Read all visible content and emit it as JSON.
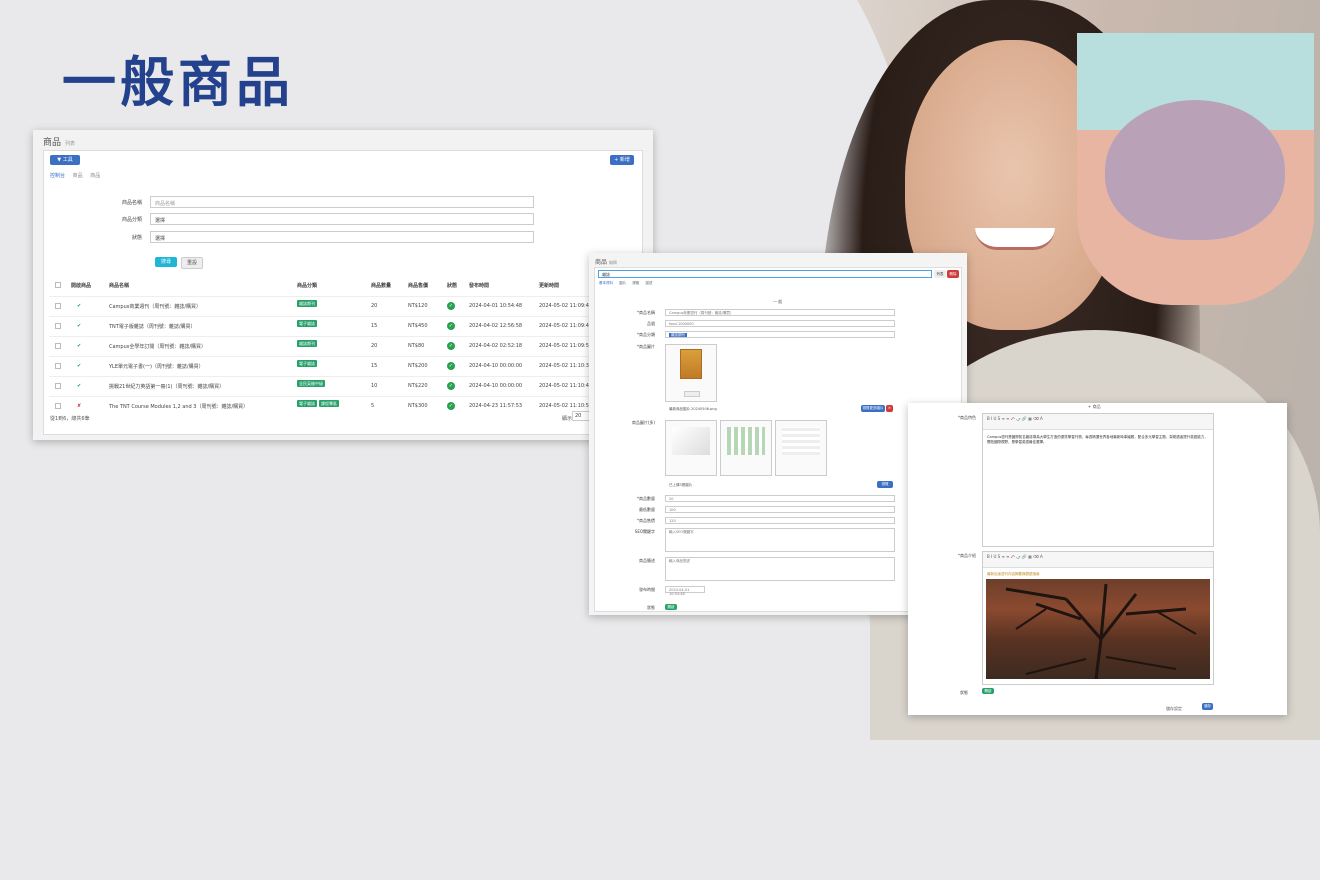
{
  "headline": "一般商品",
  "w1": {
    "title": "商品",
    "subtitle": "列表",
    "tools_label": "▼ 工具",
    "add_label": "+ 新增",
    "breadcrumb": [
      "控制台",
      "商品",
      "商品"
    ],
    "filters": [
      {
        "label": "商品名稱",
        "value": "商品名稱"
      },
      {
        "label": "商品分類",
        "value": "選擇"
      },
      {
        "label": "狀態",
        "value": "選擇"
      }
    ],
    "search_label": "搜尋",
    "reset_label": "重設",
    "columns": [
      "",
      "開啟商品",
      "商品名稱",
      "商品分類",
      "商品數量",
      "商品售價",
      "狀態",
      "發布時間",
      "更新時間"
    ],
    "rows": [
      {
        "enabled": "✔",
        "name": "Campus商業週刊（周刊號：雜誌/購買）",
        "tags": [
          "雜誌期刊"
        ],
        "qty": "20",
        "price": "NT$120",
        "published": "2024-04-01 10:54:48",
        "updated": "2024-05-02 11:09:49"
      },
      {
        "enabled": "✔",
        "name": "TNT電子版雜誌（周刊號：雜誌/購買）",
        "tags": [
          "電子雜誌"
        ],
        "qty": "15",
        "price": "NT$450",
        "published": "2024-04-02 12:56:58",
        "updated": "2024-05-02 11:09:40"
      },
      {
        "enabled": "✔",
        "name": "Campus全學年訂閱（周刊號：雜誌/購買）",
        "tags": [
          "雜誌期刊"
        ],
        "qty": "20",
        "price": "NT$80",
        "published": "2024-04-02 02:52:18",
        "updated": "2024-05-02 11:09:59"
      },
      {
        "enabled": "✔",
        "name": "YLE單元電子書(一)（周刊號：雜誌/購買）",
        "tags": [
          "電子雜誌"
        ],
        "qty": "15",
        "price": "NT$200",
        "published": "2024-04-10 00:00:00",
        "updated": "2024-05-02 11:10:39"
      },
      {
        "enabled": "✔",
        "name": "挑戰21世紀力英語第一冊(1)（周刊號：雜誌/購買）",
        "tags": [
          "全民英檢中級"
        ],
        "qty": "10",
        "price": "NT$220",
        "published": "2024-04-10 00:00:00",
        "updated": "2024-05-02 11:10:48"
      },
      {
        "enabled": "✘",
        "name": "The TNT Course Modules 1,2 and 3（周刊號：雜誌/購買）",
        "tags": [
          "電子雜誌",
          "課程專區"
        ],
        "qty": "5",
        "price": "NT$300",
        "published": "2024-04-23 11:57:53",
        "updated": "2024-05-02 11:10:55"
      }
    ],
    "footer": "從1到6，總共6筆",
    "per_page_label": "顯示",
    "per_page": "20"
  },
  "w2": {
    "title": "商品",
    "subtitle": "編輯",
    "name_value": "雜誌",
    "btn_list": "列表",
    "btn_delete": "刪除",
    "tabs": [
      "基本資料",
      "圖片",
      "規格",
      "描述"
    ],
    "section": "一 般",
    "fields": [
      {
        "label": "*商品名稱",
        "value": "Campus商業週刊（周刊號：雜誌/購買）"
      },
      {
        "label": "品號",
        "value": "food-1000000"
      },
      {
        "label": "*商品分類",
        "value": "雜誌期刊"
      },
      {
        "label": "*商品圖片",
        "value": ""
      }
    ],
    "image_file": "最新商品圖片.20240506.png",
    "btn_browse": "瀏覽更多圖片",
    "gallery_label": "商品圖片(多)",
    "gallery_file": "已上傳3張圖片",
    "btn_browse2": "瀏覽",
    "numbers": [
      {
        "label": "*商品數量",
        "value": "20"
      },
      {
        "label": "最低數量",
        "value": "100"
      },
      {
        "label": "*商品售價",
        "value": "120"
      }
    ],
    "seo_label": "SEO關鍵字",
    "seo_placeholder": "輸入SEO關鍵字",
    "desc_label": "商品簡述",
    "desc_placeholder": "輸入商品簡述",
    "date_label": "發布時間",
    "date_value": "2024-04-01 10:54:48",
    "status_label": "狀態",
    "status_value": "開啟"
  },
  "w3": {
    "header": "+ 商品",
    "desc_label": "*商品特色",
    "desc_text": "Campus週刊是國際知名雜誌專為大學生打造的優質學習刊物，每週精選世界各地最新時事議題，配合多元學習主題，幫助讀者提升英語能力，開拓國際視野，是學習英語最佳選擇。",
    "detail_label": "*商品介紹",
    "detail_text": "最新出版週刊內容摘要與閱讀指南",
    "status_label": "狀態",
    "status_value": "開啟",
    "footer_label": "儲存設定",
    "save_label": "儲存"
  },
  "colors": {
    "brand": "#23418c",
    "primary": "#3a6fc4",
    "success": "#27a06a",
    "danger": "#d23b3b",
    "info": "#1fb5d4"
  }
}
